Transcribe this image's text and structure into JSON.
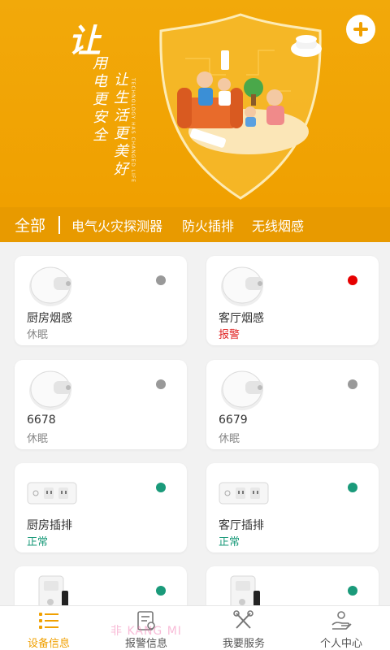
{
  "banner": {
    "slogan_big": "让",
    "slogan_line1": "用电更安全",
    "slogan_line2": "让生活更美好",
    "slogan_en": "TECHNOLOGY HAS CHANGED LIFE",
    "add_icon": "plus-icon"
  },
  "tabs": [
    {
      "label": "全部",
      "active": true
    },
    {
      "label": "电气火灾探测器",
      "active": false
    },
    {
      "label": "防火插排",
      "active": false
    },
    {
      "label": "无线烟感",
      "active": false
    }
  ],
  "devices": [
    {
      "name": "厨房烟感",
      "status": "休眠",
      "status_color": "#888888",
      "dot_color": "#999999",
      "icon": "smoke-detector-icon"
    },
    {
      "name": "客厅烟感",
      "status": "报警",
      "status_color": "#e02020",
      "dot_color": "#e60000",
      "icon": "smoke-detector-icon"
    },
    {
      "name": "6678",
      "status": "休眠",
      "status_color": "#888888",
      "dot_color": "#999999",
      "icon": "smoke-detector-icon"
    },
    {
      "name": "6679",
      "status": "休眠",
      "status_color": "#888888",
      "dot_color": "#999999",
      "icon": "smoke-detector-icon"
    },
    {
      "name": "厨房插排",
      "status": "正常",
      "status_color": "#1a9a7a",
      "dot_color": "#1a9a7a",
      "icon": "power-strip-icon"
    },
    {
      "name": "客厅插排",
      "status": "正常",
      "status_color": "#1a9a7a",
      "dot_color": "#1a9a7a",
      "icon": "power-strip-icon"
    },
    {
      "name": "",
      "status": "",
      "status_color": "#888888",
      "dot_color": "#1a9a7a",
      "icon": "detector-box-icon"
    },
    {
      "name": "",
      "status": "",
      "status_color": "#888888",
      "dot_color": "#1a9a7a",
      "icon": "detector-box-icon"
    }
  ],
  "bottom_nav": [
    {
      "label": "设备信息",
      "icon": "device-list-icon",
      "active": true
    },
    {
      "label": "报警信息",
      "icon": "alarm-doc-icon",
      "active": false
    },
    {
      "label": "我要服务",
      "icon": "tools-icon",
      "active": false
    },
    {
      "label": "个人中心",
      "icon": "hand-user-icon",
      "active": false
    }
  ],
  "colors": {
    "accent": "#f0a000",
    "normal": "#1a9a7a",
    "alarm": "#e60000",
    "sleep": "#999999"
  },
  "watermark": "非 KANG MI"
}
